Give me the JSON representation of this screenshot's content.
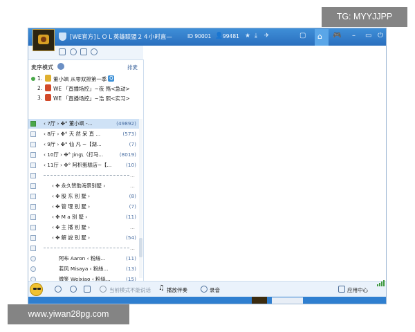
{
  "window": {
    "room_title": "[WE官方]ＬＯＬ英雄联盟２４小时直—",
    "room_id": "ID 90001",
    "user_count": "99481"
  },
  "mode": {
    "label": "麦序模式",
    "wheat_link": "排麦"
  },
  "queue": [
    {
      "num": "1.",
      "text": "董小飒 从零双排第一季"
    },
    {
      "num": "2.",
      "text": "WE 「直播场控」~夜  殇<急动>"
    },
    {
      "num": "3.",
      "text": "WE 「直播场控」~浩  熙<实习>"
    }
  ],
  "channels": [
    {
      "name": "‹ 7厅 ›  ✤° 董小飒  -...",
      "count": "(49892)"
    },
    {
      "name": "‹ 8厅 ›  ✤° 天 然 呆 直 ...",
      "count": "(573)"
    },
    {
      "name": "‹ 9厅 ›  ✤° 仙  凡  ~【湖...",
      "count": "(7)"
    },
    {
      "name": "‹ 10厅 ›  ✤° Jing\\（打马...",
      "count": "(8019)"
    },
    {
      "name": "‹ 11厅 ›  ✤° 阿枳蛋糕店~【...",
      "count": "(10)"
    },
    {
      "name": "‹ ✤ 永久赞助海景别墅 › ",
      "count": ""
    },
    {
      "name": "‹ ✤ 股  东  别  墅 ›",
      "count": "(8)"
    },
    {
      "name": "‹ ✤ 管  理  别  墅 ›",
      "count": "(7)"
    },
    {
      "name": "‹ ✤ M  a  别  墅 ›",
      "count": "(11)"
    },
    {
      "name": "‹ ✤ 主  播  别  墅 ›",
      "count": ""
    },
    {
      "name": "‹ ✤ 解  說  别  墅 ›",
      "count": "(54)"
    },
    {
      "name": "阿布 Aaron     ‹ 粉絲...",
      "count": "(11)"
    },
    {
      "name": "若风 Misaya    ‹ 粉絲...",
      "count": "(13)"
    },
    {
      "name": "微笑 Weixiao   ‹ 粉絲...",
      "count": "(15)"
    }
  ],
  "bottom": {
    "status": "当前模式不能说话",
    "accompany": "播放伴奏",
    "record": "录音",
    "app_center": "应用中心"
  },
  "watermarks": {
    "top": "TG: MYYJJPP",
    "bottom": "www.yiwan28pg.com"
  },
  "colors": {
    "titlebar": "#2a6fbe",
    "selection": "#cfe2f6",
    "accent": "#3b8fd6"
  }
}
